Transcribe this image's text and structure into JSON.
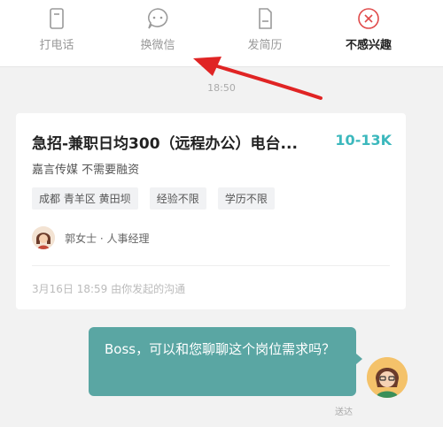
{
  "toolbar": {
    "items": [
      {
        "label": "打电话",
        "icon": "phone-icon"
      },
      {
        "label": "换微信",
        "icon": "chat-bubble-icon"
      },
      {
        "label": "发简历",
        "icon": "document-icon"
      },
      {
        "label": "不感兴趣",
        "icon": "close-circle-icon"
      }
    ]
  },
  "chat": {
    "time": "18:50",
    "job_card": {
      "title": "急招-兼职日均300（远程办公）电台...",
      "salary": "10-13K",
      "company": "嘉言传媒 不需要融资",
      "tags": [
        "成都 青羊区 黄田坝",
        "经验不限",
        "学历不限"
      ],
      "recruiter": "郭女士 · 人事经理",
      "note": "3月16日 18:59 由你发起的沟通"
    },
    "message": {
      "text": "Boss，可以和您聊聊这个岗位需求吗？",
      "status": "送达"
    }
  },
  "colors": {
    "accent": "#3cb8bd",
    "bubble": "#5aa6a3",
    "arrow": "#e02424",
    "danger": "#e04a4a"
  }
}
